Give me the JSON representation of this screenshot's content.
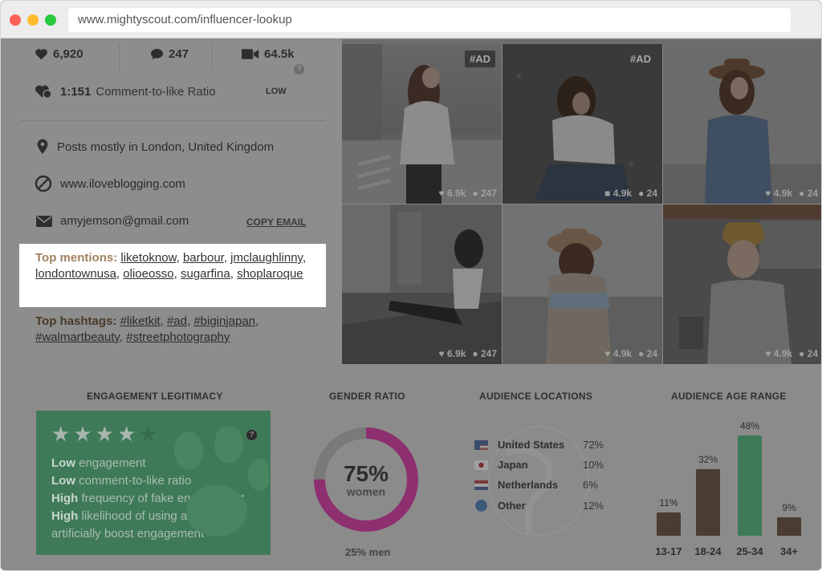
{
  "browser": {
    "url": "www.mightyscout.com/influencer-lookup"
  },
  "stats": {
    "likes": "6,920",
    "comments": "247",
    "views": "64.5k",
    "ratio_value": "1:151",
    "ratio_label": "Comment-to-like Ratio",
    "ratio_rating": "LOW"
  },
  "profile": {
    "location": "Posts mostly in London, United Kingdom",
    "website": "www.iloveblogging.com",
    "email": "amyjemson@gmail.com",
    "copy_email_label": "COPY EMAIL"
  },
  "mentions": {
    "heading": "Top mentions:",
    "items": [
      "liketoknow",
      "barbour",
      "jmclaughlinny",
      "londontownusa",
      "olioeosso",
      "sugarfina",
      "shoplaroque"
    ]
  },
  "hashtags": {
    "heading": "Top hashtags:",
    "items": [
      "#liketkit",
      "#ad",
      "#biginjapan",
      "#walmartbeauty",
      "#streetphotography"
    ]
  },
  "posts": [
    {
      "tag": "#AD",
      "likes": "6.9k",
      "comments": "247",
      "type": "photo"
    },
    {
      "tag": "#AD",
      "likes": "4.9k",
      "comments": "24",
      "type": "video"
    },
    {
      "tag": "",
      "likes": "4.9k",
      "comments": "24",
      "type": "photo"
    },
    {
      "tag": "",
      "likes": "6.9k",
      "comments": "247",
      "type": "photo"
    },
    {
      "tag": "",
      "likes": "4.9k",
      "comments": "24",
      "type": "photo"
    },
    {
      "tag": "",
      "likes": "4.9k",
      "comments": "24",
      "type": "photo"
    }
  ],
  "engagement": {
    "title": "ENGAGEMENT LEGITIMACY",
    "stars": 4,
    "lines": [
      {
        "bold": "Low",
        "rest": " engagement"
      },
      {
        "bold": "Low",
        "rest": " comment-to-like ratio"
      },
      {
        "bold": "High",
        "rest": " frequency of fake engagement"
      },
      {
        "bold": "High",
        "rest": " likelihood of using a \"pod\" to artificially boost engagement"
      }
    ]
  },
  "gender": {
    "title": "GENDER RATIO",
    "women_pct": "75%",
    "women_label": "women",
    "men_label": "25% men",
    "women_fraction": 0.75,
    "women_color": "#8e2f70",
    "men_color": "#7a7a7a"
  },
  "locations": {
    "title": "AUDIENCE LOCATIONS",
    "items": [
      {
        "name": "United States",
        "pct": "72%",
        "flag": "us-flag"
      },
      {
        "name": "Japan",
        "pct": "10%",
        "flag": "japan-flag"
      },
      {
        "name": "Netherlands",
        "pct": "6%",
        "flag": "netherlands-flag"
      },
      {
        "name": "Other",
        "pct": "12%",
        "flag": "globe-icon"
      }
    ]
  },
  "age": {
    "title": "AUDIENCE AGE RANGE",
    "highlight_color": "#3f7a58",
    "bar_color": "#4a3c30"
  },
  "chart_data": {
    "type": "bar",
    "title": "AUDIENCE AGE RANGE",
    "categories": [
      "13-17",
      "18-24",
      "25-34",
      "34+"
    ],
    "values": [
      11,
      32,
      48,
      9
    ],
    "labels": [
      "11%",
      "32%",
      "48%",
      "9%"
    ],
    "ylim": [
      0,
      48
    ],
    "highlight_index": 2
  }
}
